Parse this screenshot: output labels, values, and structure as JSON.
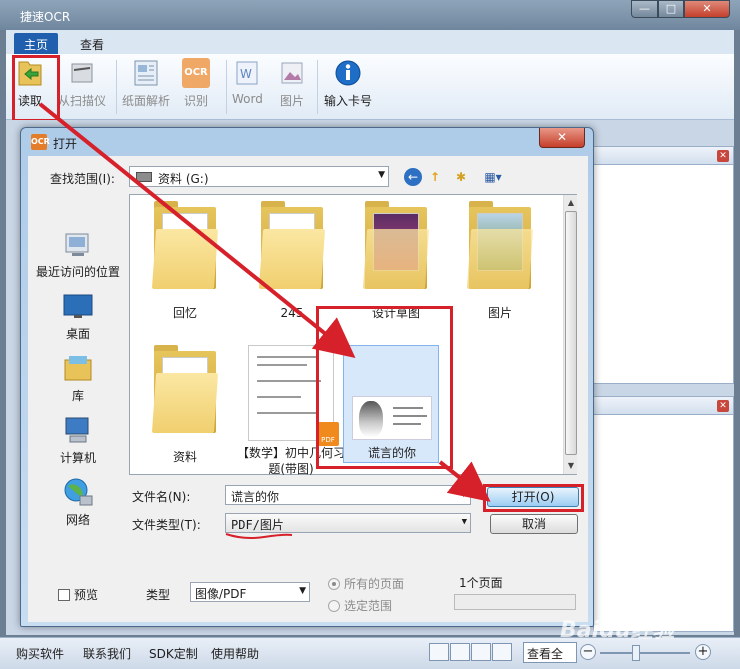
{
  "app": {
    "title": "捷速OCR",
    "window_buttons": [
      "—",
      "□",
      "✕"
    ]
  },
  "ribbon": {
    "tabs": [
      "主页",
      "查看"
    ],
    "buttons": {
      "read": "读取",
      "scan": "从扫描仪",
      "paper_parse": "纸面解析",
      "recognize": "识别",
      "word": "Word",
      "picture": "图片",
      "card": "输入卡号"
    },
    "ocr_icon_text": "OCR"
  },
  "dialog": {
    "title": "打开",
    "icon_text": "OCR",
    "close": "✕",
    "look_in_label": "查找范围(I):",
    "look_in_value": "资料 (G:)",
    "places": [
      "最近访问的位置",
      "桌面",
      "库",
      "计算机",
      "网络"
    ],
    "files": {
      "huiyi": "回忆",
      "n245": "245",
      "sheji": "设计草图",
      "tupian": "图片",
      "ziliao": "资料",
      "shuxue": "【数学】初中几何习题(带图)",
      "selected": "谎言的你"
    },
    "pdf_badge": "PDF",
    "file_name_label": "文件名(N):",
    "file_name_value": "谎言的你",
    "file_type_label": "文件类型(T):",
    "file_type_value": "PDF/图片",
    "open_button": "打开(O)",
    "cancel_button": "取消",
    "preview_label": "预览",
    "type_label": "类型",
    "type_value": "图像/PDF",
    "radio_all": "所有的页面",
    "radio_range": "选定范围",
    "page_count": "1个页面"
  },
  "statusbar": {
    "buy": "购买软件",
    "contact": "联系我们",
    "sdk": "SDK定制",
    "help": "使用帮助",
    "view_select": "查看全",
    "zoom_minus": "−",
    "zoom_plus": "+"
  },
  "watermark": "Baidu经验",
  "colors": {
    "highlight": "#d6202a",
    "active_tab": "#1f5fae",
    "selection": "#d7e8fb"
  }
}
